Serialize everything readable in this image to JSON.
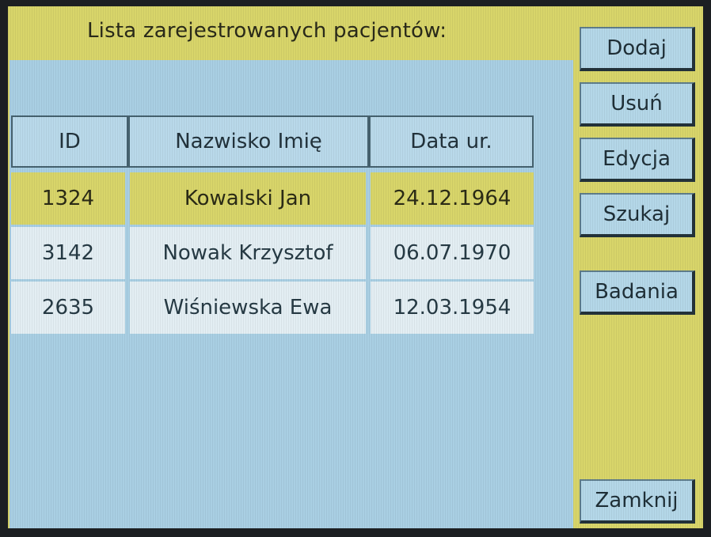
{
  "title": "Lista zarejestrowanych pacjentów:",
  "table": {
    "columns": [
      "ID",
      "Nazwisko Imię",
      "Data ur."
    ],
    "rows": [
      [
        "1324",
        "Kowalski Jan",
        "24.12.1964"
      ],
      [
        "3142",
        "Nowak Krzysztof",
        "06.07.1970"
      ],
      [
        "2635",
        "Wiśniewska Ewa",
        "12.03.1954"
      ]
    ],
    "selected_row": 0
  },
  "buttons": {
    "add": "Dodaj",
    "remove": "Usuń",
    "edit": "Edycja",
    "search": "Szukaj",
    "tests": "Badania",
    "close": "Zamknij"
  },
  "colors": {
    "yellow_panel": "#d8d56a",
    "blue_panel": "#a9cfe3",
    "button_face": "#b4d7e8"
  }
}
